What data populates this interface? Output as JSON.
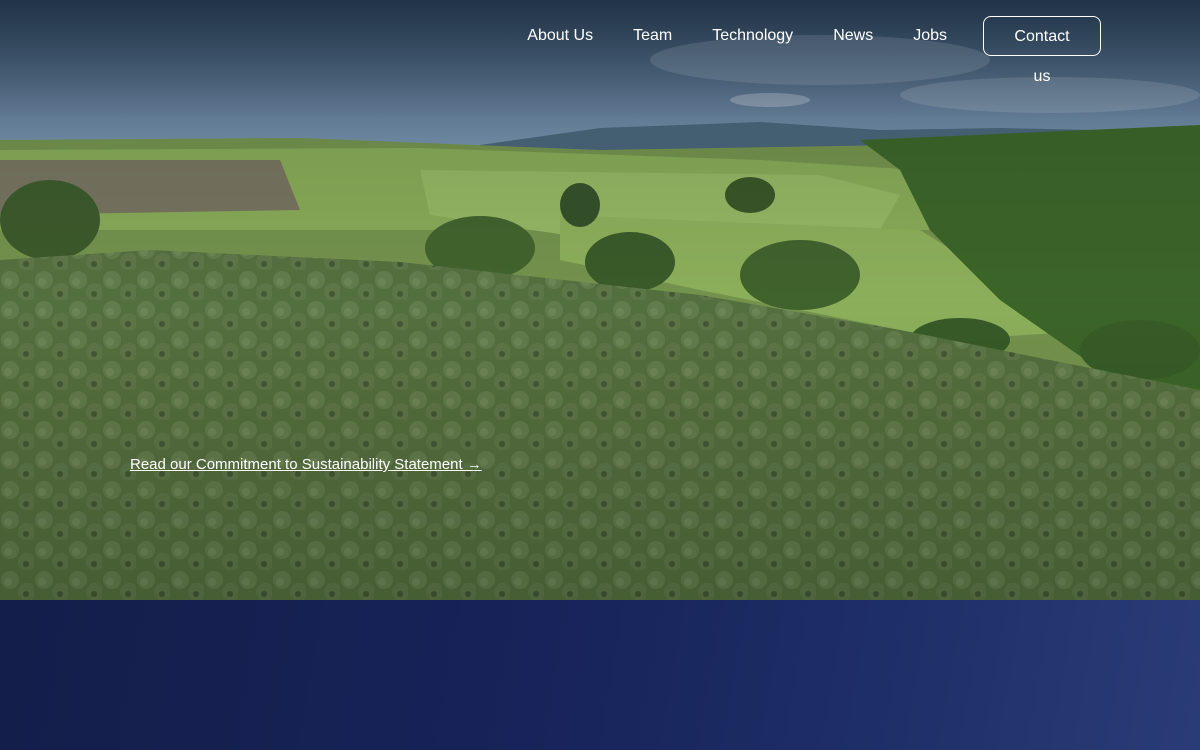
{
  "nav": {
    "items": [
      "About Us",
      "Team",
      "Technology",
      "News",
      "Jobs"
    ],
    "contact_label": "Contact us"
  },
  "hero": {
    "link_text": "Read our Commitment to Sustainability Statement →"
  },
  "colors": {
    "footer_bg": "#17235a",
    "text": "#ffffff"
  }
}
